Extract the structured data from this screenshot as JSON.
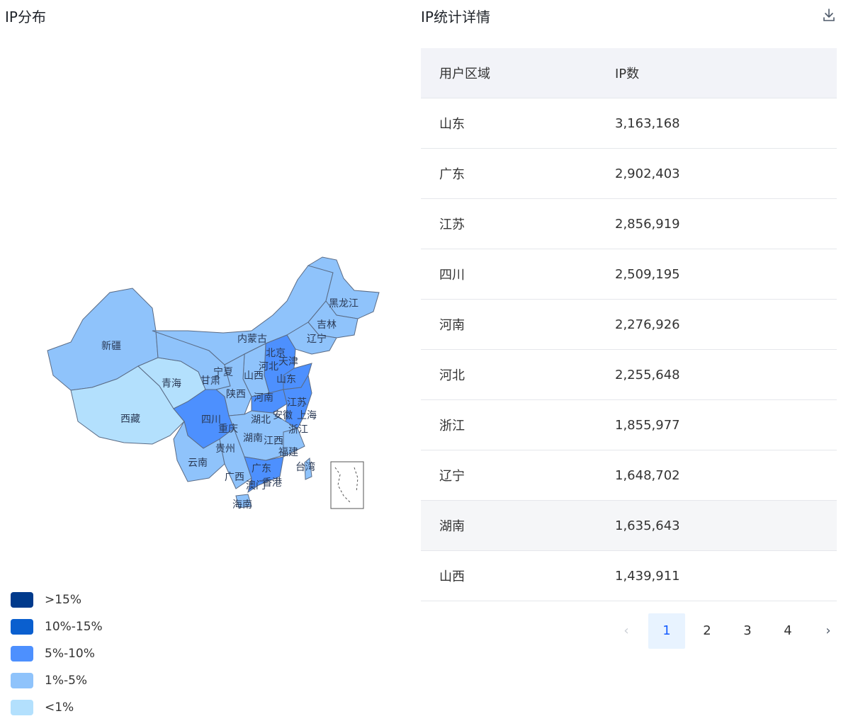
{
  "left": {
    "title": "IP分布",
    "map_labels": [
      "新疆",
      "西藏",
      "青海",
      "甘肃",
      "宁夏",
      "内蒙古",
      "黑龙江",
      "吉林",
      "辽宁",
      "北京",
      "天津",
      "河北",
      "山西",
      "陕西",
      "山东",
      "河南",
      "四川",
      "重庆",
      "湖北",
      "安徽",
      "江苏",
      "上海",
      "浙江",
      "湖南",
      "江西",
      "贵州",
      "云南",
      "广西",
      "广东",
      "福建",
      "台湾",
      "海南",
      "香港",
      "澳门"
    ],
    "legend": [
      {
        "label": ">15%",
        "color": "#003a8c"
      },
      {
        "label": "10%-15%",
        "color": "#0a5fcf"
      },
      {
        "label": "5%-10%",
        "color": "#4d90fe"
      },
      {
        "label": "1%-5%",
        "color": "#8fc3fb"
      },
      {
        "label": "<1%",
        "color": "#b3e0fd"
      }
    ]
  },
  "right": {
    "title": "IP统计详情",
    "download_icon": "download-icon",
    "columns": [
      "用户区域",
      "IP数"
    ],
    "rows": [
      {
        "region": "山东",
        "count": "3,163,168"
      },
      {
        "region": "广东",
        "count": "2,902,403"
      },
      {
        "region": "江苏",
        "count": "2,856,919"
      },
      {
        "region": "四川",
        "count": "2,509,195"
      },
      {
        "region": "河南",
        "count": "2,276,926"
      },
      {
        "region": "河北",
        "count": "2,255,648"
      },
      {
        "region": "浙江",
        "count": "1,855,977"
      },
      {
        "region": "辽宁",
        "count": "1,648,702"
      },
      {
        "region": "湖南",
        "count": "1,635,643"
      },
      {
        "region": "山西",
        "count": "1,439,911"
      }
    ],
    "pagination": {
      "pages": [
        "1",
        "2",
        "3",
        "4"
      ],
      "current": "1",
      "prev": "‹",
      "next": "›"
    }
  }
}
